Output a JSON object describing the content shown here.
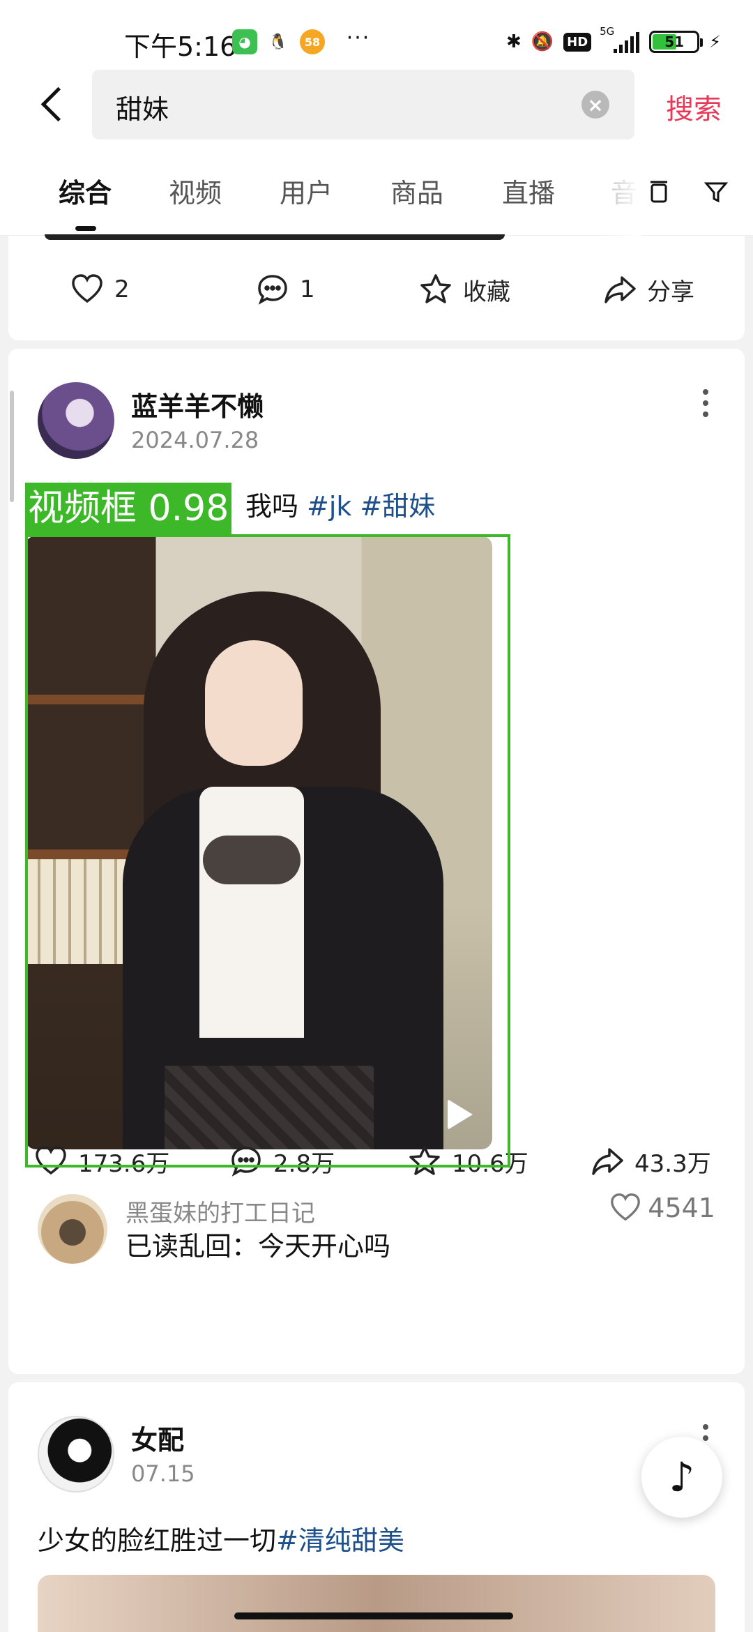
{
  "status_bar": {
    "time": "下午5:16",
    "network": "5G",
    "hd": "HD",
    "battery": "51",
    "more": "···"
  },
  "search": {
    "query": "甜妹",
    "submit_label": "搜索"
  },
  "tabs": [
    {
      "label": "综合",
      "active": true
    },
    {
      "label": "视频"
    },
    {
      "label": "用户"
    },
    {
      "label": "商品"
    },
    {
      "label": "直播"
    },
    {
      "label": "音"
    }
  ],
  "previous_post": {
    "likes": "2",
    "comments": "1",
    "favorite": "收藏",
    "share": "分享"
  },
  "main_post": {
    "author": "蓝羊羊不懒",
    "date": "2024.07.28",
    "caption_text": "我吗",
    "hashtags": [
      "#jk",
      "#甜妹"
    ],
    "detection_label": "视频框 0.98",
    "stats": {
      "likes": "173.6万",
      "comments": "2.8万",
      "favorites": "10.6万",
      "shares": "43.3万"
    },
    "top_comment": {
      "user": "黑蛋妹的打工日记",
      "text": "已读乱回：今天开心吗",
      "likes": "4541"
    }
  },
  "next_post": {
    "author": "女配",
    "date": "07.15",
    "caption_text": "少女的脸红胜过一切",
    "hashtag": "#清纯甜美"
  },
  "colors": {
    "accent": "#e8385a",
    "hashtag": "#1d4f8a",
    "detection": "#3cb828"
  },
  "icons": [
    "back-arrow-icon",
    "clear-icon",
    "collection-icon",
    "filter-icon",
    "heart-icon",
    "comment-icon",
    "star-icon",
    "share-icon",
    "play-icon",
    "more-icon",
    "douyin-icon"
  ]
}
